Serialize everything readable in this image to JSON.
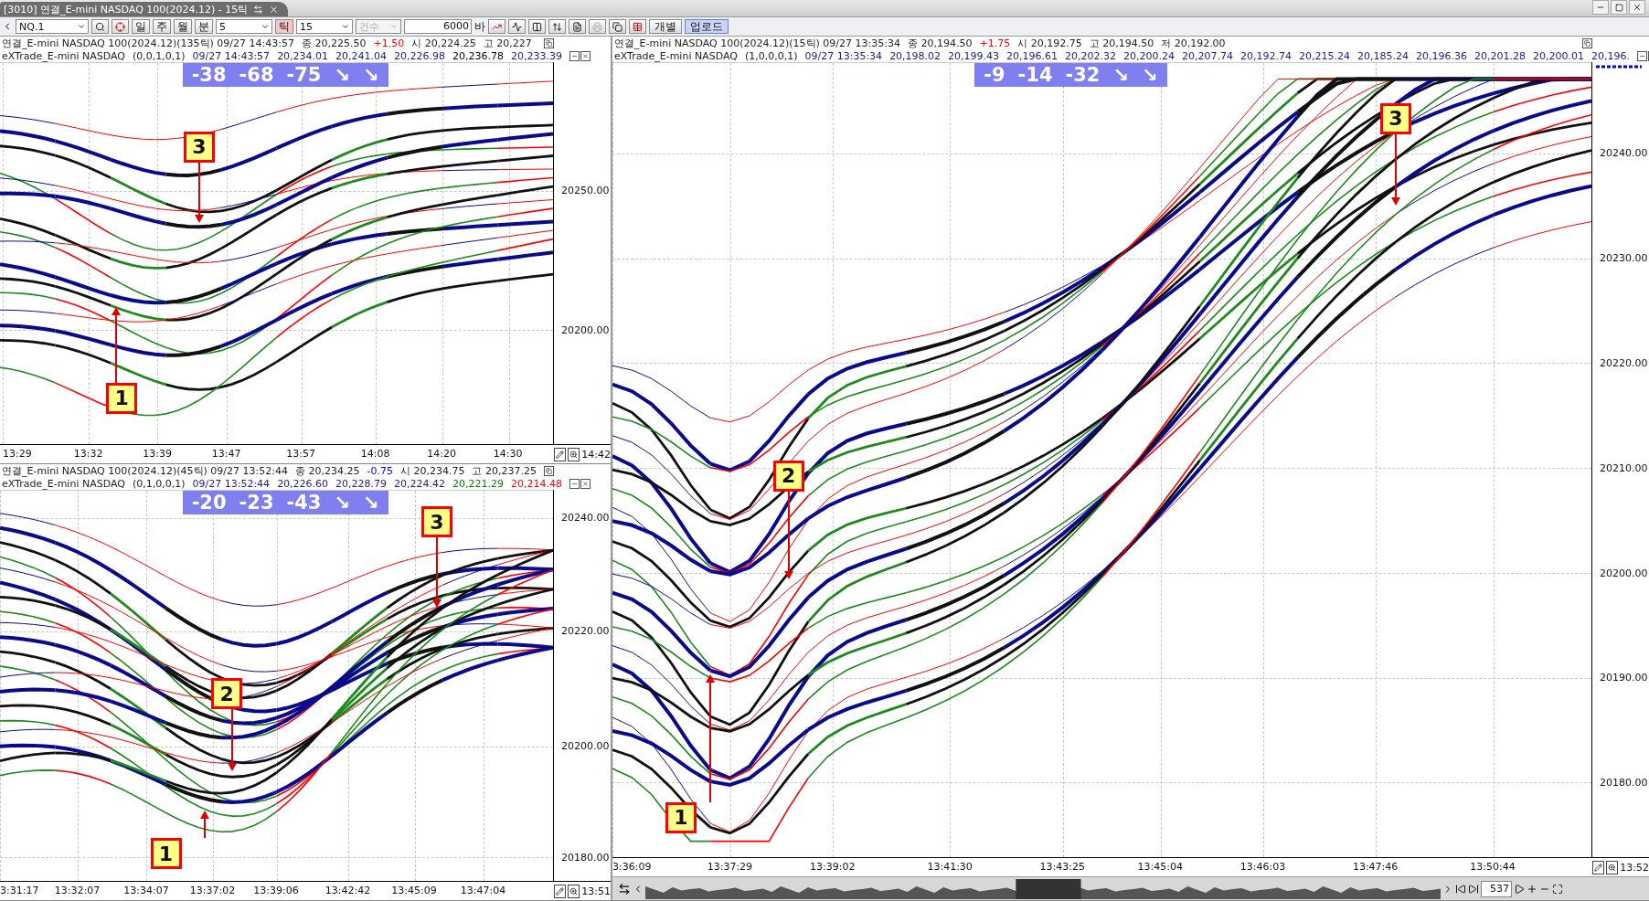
{
  "window": {
    "title": "[3010] 연결_E-mini NASDAQ 100(2024.12) - 15틱"
  },
  "toolbar": {
    "symbol": "NQ.1",
    "periods": [
      {
        "label": "일",
        "selected": false
      },
      {
        "label": "주",
        "selected": false
      },
      {
        "label": "월",
        "selected": false
      },
      {
        "label": "분",
        "selected": false
      }
    ],
    "minute_value": "5",
    "tick": {
      "label": "틱",
      "selected": true
    },
    "tick_value": "15",
    "count": {
      "label": "건수",
      "disabled": true
    },
    "bar_count": "6000",
    "bar_unit": "바",
    "buttons": [
      {
        "label": "개별",
        "selected": false
      },
      {
        "label": "업로드",
        "selected": true
      }
    ]
  },
  "panels": [
    {
      "header": [
        {
          "text": "연결_E-mini NASDAQ 100(2024.12)(135틱) 09/27 14:43:57"
        },
        {
          "text": "종 20,225.50"
        },
        {
          "text": "+1.50",
          "color": "#ff0000"
        },
        {
          "text": "시 20,224.25"
        },
        {
          "text": "고 20,227"
        }
      ],
      "series": {
        "name": "eXTrade_E-mini NASDAQ",
        "params": "(0,0,1,0,1)",
        "values": [
          {
            "text": "09/27 14:43:57",
            "color": "#1a1a8c"
          },
          {
            "text": "20,234.01",
            "color": "#1a1a8c"
          },
          {
            "text": "20,241.04",
            "color": "#1a1a8c"
          },
          {
            "text": "20,226.98",
            "color": "#1a1a8c"
          },
          {
            "text": "20,236.78",
            "color": "#000000"
          },
          {
            "text": "20,233.39",
            "color": "#1a1a8c"
          }
        ]
      },
      "badge": {
        "values": [
          "-38",
          "-68",
          "-75"
        ],
        "arrows": [
          "↘",
          "↘"
        ]
      },
      "yticks": [
        "20250.00",
        "20200.00"
      ],
      "times": [
        "13:29",
        "13:32",
        "13:39",
        "13:47",
        "13:57",
        "14:08",
        "14:20",
        "14:30",
        "14:42"
      ],
      "annotations": [
        {
          "label": "3"
        },
        {
          "label": "1"
        }
      ]
    },
    {
      "header": [
        {
          "text": "연결_E-mini NASDAQ 100(2024.12)(45틱) 09/27 13:52:44"
        },
        {
          "text": "종 20,234.25"
        },
        {
          "text": "-0.75",
          "color": "#0000ff"
        },
        {
          "text": "시 20,234.75"
        },
        {
          "text": "고 20,237.25"
        }
      ],
      "series": {
        "name": "eXTrade_E-mini NASDAQ",
        "params": "(0,1,0,0,1)",
        "values": [
          {
            "text": "09/27 13:52:44",
            "color": "#1a1a8c"
          },
          {
            "text": "20,226.60",
            "color": "#1a1a8c"
          },
          {
            "text": "20,228.79",
            "color": "#1a1a8c"
          },
          {
            "text": "20,224.42",
            "color": "#1a1a8c"
          },
          {
            "text": "20,221.29",
            "color": "#008000"
          },
          {
            "text": "20,214.48",
            "color": "#ff0000"
          }
        ]
      },
      "badge": {
        "values": [
          "-20",
          "-23",
          "-43"
        ],
        "arrows": [
          "↘",
          "↘"
        ]
      },
      "yticks": [
        "20240.00",
        "20220.00",
        "20200.00",
        "20180.00"
      ],
      "times": [
        "3:31:17",
        "13:32:07",
        "13:34:07",
        "13:37:02",
        "13:39:06",
        "13:42:42",
        "13:45:09",
        "13:47:04",
        "13:51"
      ],
      "annotations": [
        {
          "label": "1"
        },
        {
          "label": "2"
        },
        {
          "label": "3"
        }
      ]
    },
    {
      "header": [
        {
          "text": "연결_E-mini NASDAQ 100(2024.12)(15틱) 09/27 13:35:34"
        },
        {
          "text": "종 20,194.50"
        },
        {
          "text": "+1.75",
          "color": "#ff0000"
        },
        {
          "text": "시 20,192.75"
        },
        {
          "text": "고 20,194.50"
        },
        {
          "text": "저 20,192.00"
        }
      ],
      "series": {
        "name": "eXTrade_E-mini NASDAQ",
        "params": "(1,0,0,0,1)",
        "values": [
          {
            "text": "09/27 13:35:34",
            "color": "#1a1a8c"
          },
          {
            "text": "20,198.02",
            "color": "#1a1a8c"
          },
          {
            "text": "20,199.43",
            "color": "#1a1a8c"
          },
          {
            "text": "20,196.61",
            "color": "#1a1a8c"
          },
          {
            "text": "20,202.32",
            "color": "#1a1a8c"
          },
          {
            "text": "20,200.24",
            "color": "#1a1a8c"
          },
          {
            "text": "20,207.74",
            "color": "#1a1a8c"
          },
          {
            "text": "20,192.74",
            "color": "#1a1a8c"
          },
          {
            "text": "20,215.24",
            "color": "#1a1a8c"
          },
          {
            "text": "20,185.24",
            "color": "#1a1a8c"
          },
          {
            "text": "20,196.36",
            "color": "#1a1a8c"
          },
          {
            "text": "20,201.28",
            "color": "#1a1a8c"
          },
          {
            "text": "20,200.01",
            "color": "#1a1a8c"
          },
          {
            "text": "20,196.",
            "color": "#1a1a8c"
          }
        ]
      },
      "badge": {
        "values": [
          "-9",
          "-14",
          "-32"
        ],
        "arrows": [
          "↘",
          "↘"
        ]
      },
      "yticks": [
        "20240.00",
        "20230.00",
        "20220.00",
        "20210.00",
        "20200.00",
        "20190.00",
        "20180.00"
      ],
      "times": [
        "3:36:09",
        "13:37:29",
        "13:39:02",
        "13:41:30",
        "13:43:25",
        "13:45:04",
        "13:46:03",
        "13:47:46",
        "13:50:44",
        "13:52"
      ],
      "annotations": [
        {
          "label": "1"
        },
        {
          "label": "2"
        },
        {
          "label": "3"
        }
      ],
      "scrollbar": {
        "count": "537"
      }
    }
  ]
}
